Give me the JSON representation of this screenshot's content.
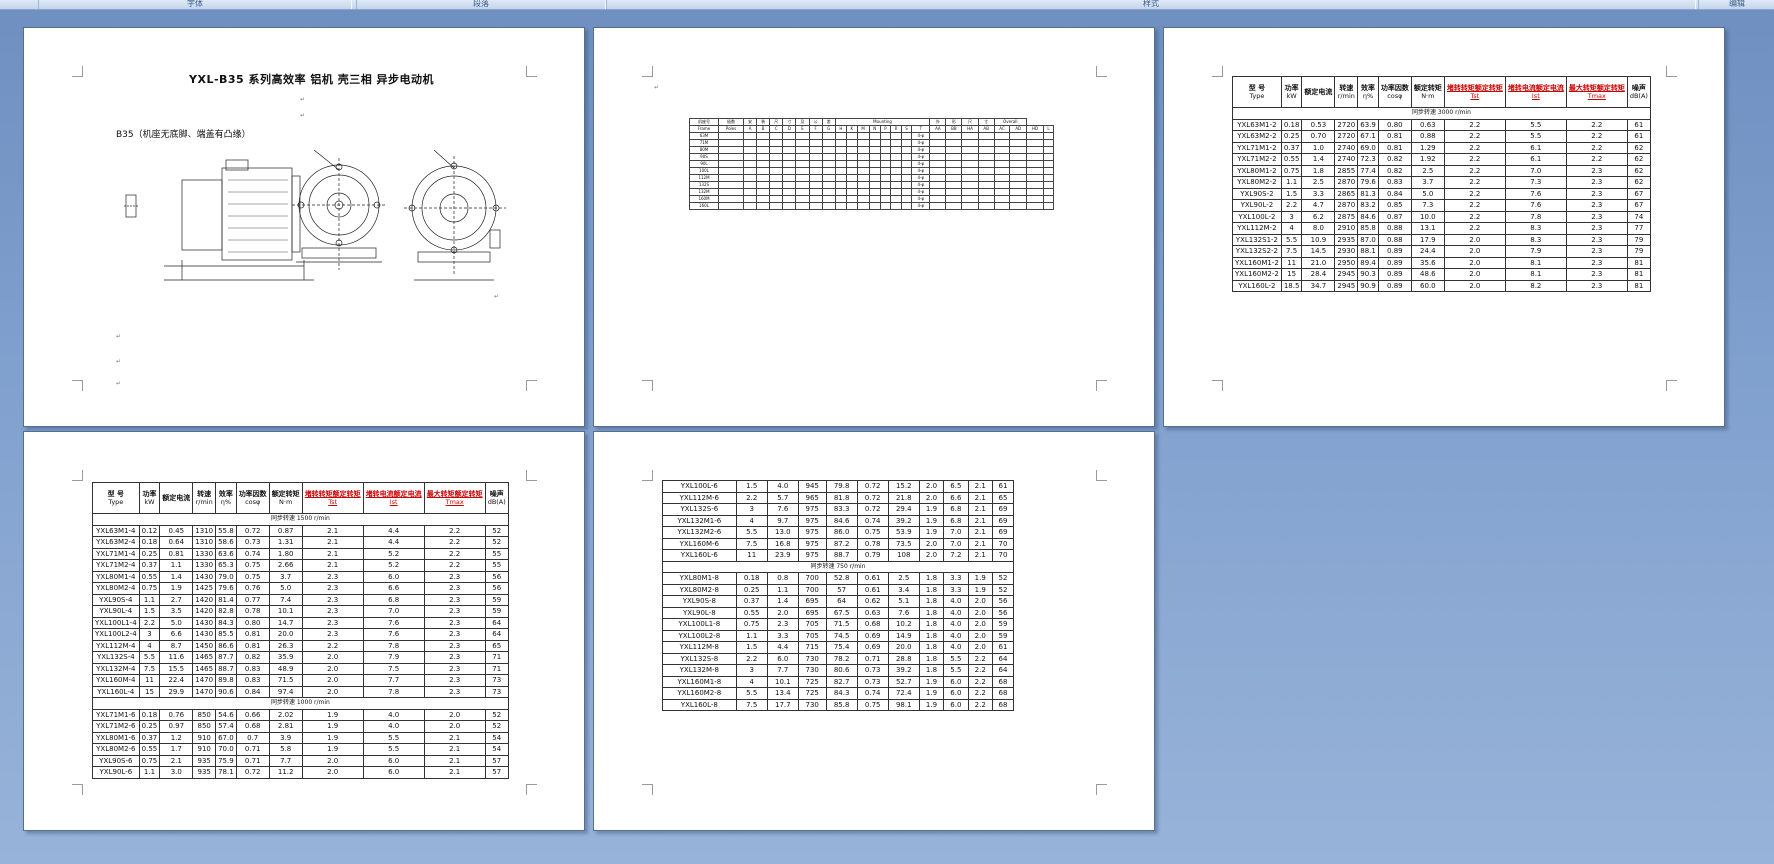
{
  "ribbon": {
    "groups": [
      "字体",
      "段落",
      "样式",
      "编辑"
    ]
  },
  "page1": {
    "title": "YXL-B35 系列高效率 铝机 壳三相 异步电动机",
    "b35_label": "B35（机座无底脚、端盖有凸缘）"
  },
  "page2": {
    "headers": [
      "机座号",
      "极数",
      "安",
      "装",
      "尺",
      "寸",
      "及",
      "公",
      "差",
      "Mounting",
      "外",
      "形",
      "尺",
      "寸",
      "Overall"
    ],
    "sub_headers": [
      "Frame",
      "Poles",
      "A",
      "B",
      "C",
      "D",
      "E",
      "F",
      "G",
      "H",
      "K",
      "M",
      "N",
      "P",
      "R",
      "S",
      "T",
      "AA",
      "BB",
      "HA",
      "AB",
      "AC",
      "AD",
      "HD",
      "L"
    ],
    "frames": [
      "63M",
      "71M",
      "80M",
      "90S",
      "90L",
      "100L",
      "112M",
      "132S",
      "132M",
      "160M",
      "160L"
    ],
    "mounting_label": "4-φ"
  },
  "spec_header": {
    "model_cn": "型 号",
    "model_en": "Type",
    "power_cn": "功率",
    "power_en": "kW",
    "current_cn": "额定电流",
    "speed_cn": "转速",
    "speed_en": "r/min",
    "eff_cn": "效率",
    "eff_en": "η%",
    "pf_cn": "功率因数",
    "pf_en": "cosφ",
    "torque_cn": "额定转矩",
    "torque_en": "N·m",
    "start_torque_cn": "堵转转矩额定转矩",
    "start_torque_en": "Tst",
    "start_current_cn": "堵转电流额定电流",
    "start_current_en": "Ist",
    "max_torque_cn": "最大转矩额定转矩",
    "max_torque_en": "Tmax",
    "noise_cn": "噪声",
    "noise_en": "dB(A)"
  },
  "page3": {
    "section": "同步转速 3000 r/min",
    "rows": [
      [
        "YXL63M1-2",
        "0.18",
        "0.53",
        "2720",
        "63.9",
        "0.80",
        "0.63",
        "2.2",
        "5.5",
        "2.2",
        "61"
      ],
      [
        "YXL63M2-2",
        "0.25",
        "0.70",
        "2720",
        "67.1",
        "0.81",
        "0.88",
        "2.2",
        "5.5",
        "2.2",
        "61"
      ],
      [
        "YXL71M1-2",
        "0.37",
        "1.0",
        "2740",
        "69.0",
        "0.81",
        "1.29",
        "2.2",
        "6.1",
        "2.2",
        "62"
      ],
      [
        "YXL71M2-2",
        "0.55",
        "1.4",
        "2740",
        "72.3",
        "0.82",
        "1.92",
        "2.2",
        "6.1",
        "2.2",
        "62"
      ],
      [
        "YXL80M1-2",
        "0.75",
        "1.8",
        "2855",
        "77.4",
        "0.82",
        "2.5",
        "2.2",
        "7.0",
        "2.3",
        "62"
      ],
      [
        "YXL80M2-2",
        "1.1",
        "2.5",
        "2870",
        "79.6",
        "0.83",
        "3.7",
        "2.2",
        "7.3",
        "2.3",
        "62"
      ],
      [
        "YXL90S-2",
        "1.5",
        "3.3",
        "2865",
        "81.3",
        "0.84",
        "5.0",
        "2.2",
        "7.6",
        "2.3",
        "67"
      ],
      [
        "YXL90L-2",
        "2.2",
        "4.7",
        "2870",
        "83.2",
        "0.85",
        "7.3",
        "2.2",
        "7.6",
        "2.3",
        "67"
      ],
      [
        "YXL100L-2",
        "3",
        "6.2",
        "2875",
        "84.6",
        "0.87",
        "10.0",
        "2.2",
        "7.8",
        "2.3",
        "74"
      ],
      [
        "YXL112M-2",
        "4",
        "8.0",
        "2910",
        "85.8",
        "0.88",
        "13.1",
        "2.2",
        "8.3",
        "2.3",
        "77"
      ],
      [
        "YXL132S1-2",
        "5.5",
        "10.9",
        "2935",
        "87.0",
        "0.88",
        "17.9",
        "2.0",
        "8.3",
        "2.3",
        "79"
      ],
      [
        "YXL132S2-2",
        "7.5",
        "14.5",
        "2930",
        "88.1",
        "0.89",
        "24.4",
        "2.0",
        "7.9",
        "2.3",
        "79"
      ],
      [
        "YXL160M1-2",
        "11",
        "21.0",
        "2950",
        "89.4",
        "0.89",
        "35.6",
        "2.0",
        "8.1",
        "2.3",
        "81"
      ],
      [
        "YXL160M2-2",
        "15",
        "28.4",
        "2945",
        "90.3",
        "0.89",
        "48.6",
        "2.0",
        "8.1",
        "2.3",
        "81"
      ],
      [
        "YXL160L-2",
        "18.5",
        "34.7",
        "2945",
        "90.9",
        "0.89",
        "60.0",
        "2.0",
        "8.2",
        "2.3",
        "81"
      ]
    ]
  },
  "page4": {
    "section1": "同步转速 1500 r/min",
    "rows1": [
      [
        "YXL63M1-4",
        "0.12",
        "0.45",
        "1310",
        "55.8",
        "0.72",
        "0.87",
        "2.1",
        "4.4",
        "2.2",
        "52"
      ],
      [
        "YXL63M2-4",
        "0.18",
        "0.64",
        "1310",
        "58.6",
        "0.73",
        "1.31",
        "2.1",
        "4.4",
        "2.2",
        "52"
      ],
      [
        "YXL71M1-4",
        "0.25",
        "0.81",
        "1330",
        "63.6",
        "0.74",
        "1.80",
        "2.1",
        "5.2",
        "2.2",
        "55"
      ],
      [
        "YXL71M2-4",
        "0.37",
        "1.1",
        "1330",
        "65.3",
        "0.75",
        "2.66",
        "2.1",
        "5.2",
        "2.2",
        "55"
      ],
      [
        "YXL80M1-4",
        "0.55",
        "1.4",
        "1430",
        "79.0",
        "0.75",
        "3.7",
        "2.3",
        "6.0",
        "2.3",
        "56"
      ],
      [
        "YXL80M2-4",
        "0.75",
        "1.9",
        "1425",
        "79.6",
        "0.76",
        "5.0",
        "2.3",
        "6.6",
        "2.3",
        "56"
      ],
      [
        "YXL90S-4",
        "1.1",
        "2.7",
        "1420",
        "81.4",
        "0.77",
        "7.4",
        "2.3",
        "6.8",
        "2.3",
        "59"
      ],
      [
        "YXL90L-4",
        "1.5",
        "3.5",
        "1420",
        "82.8",
        "0.78",
        "10.1",
        "2.3",
        "7.0",
        "2.3",
        "59"
      ],
      [
        "YXL100L1-4",
        "2.2",
        "5.0",
        "1430",
        "84.3",
        "0.80",
        "14.7",
        "2.3",
        "7.6",
        "2.3",
        "64"
      ],
      [
        "YXL100L2-4",
        "3",
        "6.6",
        "1430",
        "85.5",
        "0.81",
        "20.0",
        "2.3",
        "7.6",
        "2.3",
        "64"
      ],
      [
        "YXL112M-4",
        "4",
        "8.7",
        "1450",
        "86.6",
        "0.81",
        "26.3",
        "2.2",
        "7.8",
        "2.3",
        "65"
      ],
      [
        "YXL132S-4",
        "5.5",
        "11.6",
        "1465",
        "87.7",
        "0.82",
        "35.9",
        "2.0",
        "7.9",
        "2.3",
        "71"
      ],
      [
        "YXL132M-4",
        "7.5",
        "15.5",
        "1465",
        "88.7",
        "0.83",
        "48.9",
        "2.0",
        "7.5",
        "2.3",
        "71"
      ],
      [
        "YXL160M-4",
        "11",
        "22.4",
        "1470",
        "89.8",
        "0.83",
        "71.5",
        "2.0",
        "7.7",
        "2.3",
        "73"
      ],
      [
        "YXL160L-4",
        "15",
        "29.9",
        "1470",
        "90.6",
        "0.84",
        "97.4",
        "2.0",
        "7.8",
        "2.3",
        "73"
      ]
    ],
    "section2": "同步转速 1000 r/min",
    "rows2": [
      [
        "YXL71M1-6",
        "0.18",
        "0.76",
        "850",
        "54.6",
        "0.66",
        "2.02",
        "1.9",
        "4.0",
        "2.0",
        "52"
      ],
      [
        "YXL71M2-6",
        "0.25",
        "0.97",
        "850",
        "57.4",
        "0.68",
        "2.81",
        "1.9",
        "4.0",
        "2.0",
        "52"
      ],
      [
        "YXL80M1-6",
        "0.37",
        "1.2",
        "910",
        "67.0",
        "0.7",
        "3.9",
        "1.9",
        "5.5",
        "2.1",
        "54"
      ],
      [
        "YXL80M2-6",
        "0.55",
        "1.7",
        "910",
        "70.0",
        "0.71",
        "5.8",
        "1.9",
        "5.5",
        "2.1",
        "54"
      ],
      [
        "YXL90S-6",
        "0.75",
        "2.1",
        "935",
        "75.9",
        "0.71",
        "7.7",
        "2.0",
        "6.0",
        "2.1",
        "57"
      ],
      [
        "YXL90L-6",
        "1.1",
        "3.0",
        "935",
        "78.1",
        "0.72",
        "11.2",
        "2.0",
        "6.0",
        "2.1",
        "57"
      ]
    ]
  },
  "page5": {
    "rows1": [
      [
        "YXL100L-6",
        "1.5",
        "4.0",
        "945",
        "79.8",
        "0.72",
        "15.2",
        "2.0",
        "6.5",
        "2.1",
        "61"
      ],
      [
        "YXL112M-6",
        "2.2",
        "5.7",
        "965",
        "81.8",
        "0.72",
        "21.8",
        "2.0",
        "6.6",
        "2.1",
        "65"
      ],
      [
        "YXL132S-6",
        "3",
        "7.6",
        "975",
        "83.3",
        "0.72",
        "29.4",
        "1.9",
        "6.8",
        "2.1",
        "69"
      ],
      [
        "YXL132M1-6",
        "4",
        "9.7",
        "975",
        "84.6",
        "0.74",
        "39.2",
        "1.9",
        "6.8",
        "2.1",
        "69"
      ],
      [
        "YXL132M2-6",
        "5.5",
        "13.0",
        "975",
        "86.0",
        "0.75",
        "53.9",
        "1.9",
        "7.0",
        "2.1",
        "69"
      ],
      [
        "YXL160M-6",
        "7.5",
        "16.8",
        "975",
        "87.2",
        "0.78",
        "73.5",
        "2.0",
        "7.0",
        "2.1",
        "70"
      ],
      [
        "YXL160L-6",
        "11",
        "23.9",
        "975",
        "88.7",
        "0.79",
        "108",
        "2.0",
        "7.2",
        "2.1",
        "70"
      ]
    ],
    "section": "同步转速 750 r/min",
    "rows2": [
      [
        "YXL80M1-8",
        "0.18",
        "0.8",
        "700",
        "52.8",
        "0.61",
        "2.5",
        "1.8",
        "3.3",
        "1.9",
        "52"
      ],
      [
        "YXL80M2-8",
        "0.25",
        "1.1",
        "700",
        "57",
        "0.61",
        "3.4",
        "1.8",
        "3.3",
        "1.9",
        "52"
      ],
      [
        "YXL90S-8",
        "0.37",
        "1.4",
        "695",
        "64",
        "0.62",
        "5.1",
        "1.8",
        "4.0",
        "2.0",
        "56"
      ],
      [
        "YXL90L-8",
        "0.55",
        "2.0",
        "695",
        "67.5",
        "0.63",
        "7.6",
        "1.8",
        "4.0",
        "2.0",
        "56"
      ],
      [
        "YXL100L1-8",
        "0.75",
        "2.3",
        "705",
        "71.5",
        "0.68",
        "10.2",
        "1.8",
        "4.0",
        "2.0",
        "59"
      ],
      [
        "YXL100L2-8",
        "1.1",
        "3.3",
        "705",
        "74.5",
        "0.69",
        "14.9",
        "1.8",
        "4.0",
        "2.0",
        "59"
      ],
      [
        "YXL112M-8",
        "1.5",
        "4.4",
        "715",
        "75.4",
        "0.69",
        "20.0",
        "1.8",
        "4.0",
        "2.0",
        "61"
      ],
      [
        "YXL132S-8",
        "2.2",
        "6.0",
        "730",
        "78.2",
        "0.71",
        "28.8",
        "1.8",
        "5.5",
        "2.2",
        "64"
      ],
      [
        "YXL132M-8",
        "3",
        "7.7",
        "730",
        "80.6",
        "0.73",
        "39.2",
        "1.8",
        "5.5",
        "2.2",
        "64"
      ],
      [
        "YXL160M1-8",
        "4",
        "10.1",
        "725",
        "82.7",
        "0.73",
        "52.7",
        "1.9",
        "6.0",
        "2.2",
        "68"
      ],
      [
        "YXL160M2-8",
        "5.5",
        "13.4",
        "725",
        "84.3",
        "0.74",
        "72.4",
        "1.9",
        "6.0",
        "2.2",
        "68"
      ],
      [
        "YXL160L-8",
        "7.5",
        "17.7",
        "730",
        "85.8",
        "0.75",
        "98.1",
        "1.9",
        "6.0",
        "2.2",
        "68"
      ]
    ]
  }
}
